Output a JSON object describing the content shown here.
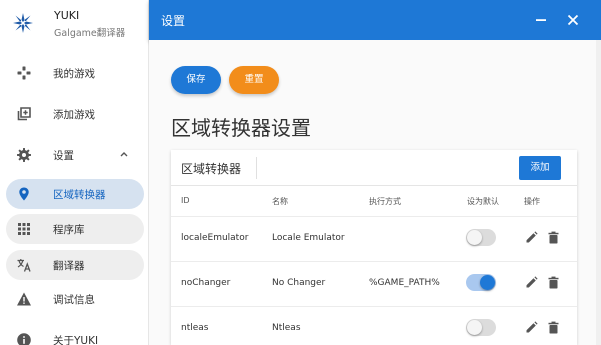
{
  "app": {
    "title": "YUKI",
    "subtitle": "Galgame翻译器"
  },
  "sidebar": {
    "items": [
      {
        "label": "我的游戏",
        "icon": "gamepad-icon"
      },
      {
        "label": "添加游戏",
        "icon": "add-box-icon"
      },
      {
        "label": "设置",
        "icon": "gear-icon",
        "expanded": true
      },
      {
        "label": "区域转换器",
        "icon": "location-pin-icon",
        "active": true
      },
      {
        "label": "程序库",
        "icon": "grid-icon"
      },
      {
        "label": "翻译器",
        "icon": "translate-icon"
      },
      {
        "label": "调试信息",
        "icon": "warning-icon"
      },
      {
        "label": "关于YUKI",
        "icon": "info-icon"
      }
    ]
  },
  "header": {
    "title": "设置"
  },
  "toolbar": {
    "save_label": "保存",
    "reset_label": "重置"
  },
  "page": {
    "heading": "区域转换器设置"
  },
  "card": {
    "title": "区域转换器",
    "add_label": "添加",
    "columns": [
      "ID",
      "名称",
      "执行方式",
      "设为默认",
      "操作"
    ],
    "rows": [
      {
        "id": "localeEmulator",
        "name": "Locale Emulator",
        "exec": "",
        "default": false
      },
      {
        "id": "noChanger",
        "name": "No Changer",
        "exec": "%GAME_PATH%",
        "default": true
      },
      {
        "id": "ntleas",
        "name": "Ntleas",
        "exec": "",
        "default": false
      }
    ]
  },
  "colors": {
    "primary": "#1e78d6",
    "accent": "#f28d1b",
    "active_nav_bg": "#d6e2f0"
  }
}
